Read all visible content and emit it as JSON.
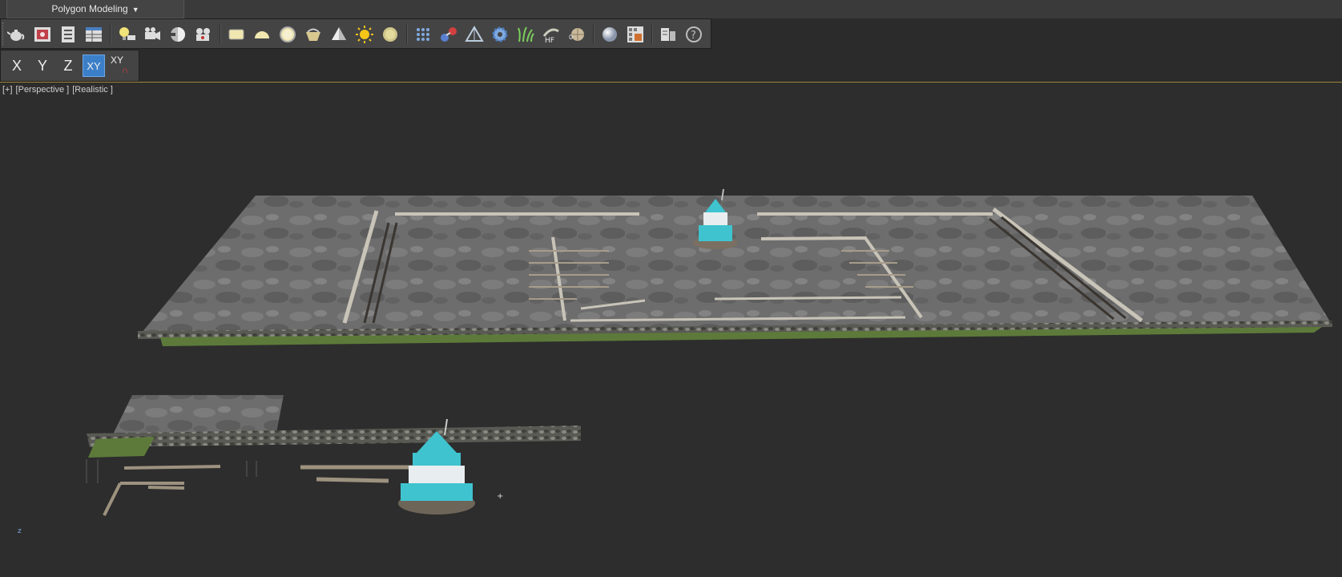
{
  "ribbon": {
    "tab_label": "Polygon Modeling"
  },
  "toolbar": {
    "buttons": [
      "teapot-icon",
      "render-frame-icon",
      "render-setup-icon",
      "render-table-icon",
      "light-lister-icon",
      "camera-icon",
      "camera-sequence-icon",
      "film-icon",
      "plane-icon",
      "hemisphere-icon",
      "sphere-ring-icon",
      "basket-icon",
      "cone-icon",
      "sun-icon",
      "disc-icon",
      "particle-grid-icon",
      "molecule-icon",
      "tent-icon",
      "gear-icon",
      "grass-icon",
      "hf-icon",
      "mesh-ball-icon",
      "material-sphere-icon",
      "material-editor-icon",
      "layer-manager-icon",
      "help-icon"
    ]
  },
  "axis_toolbar": {
    "x": "X",
    "y": "Y",
    "z": "Z",
    "xy": "XY",
    "xy_snap": "XY"
  },
  "viewport": {
    "plus": "[+]",
    "view": "[Perspective ]",
    "shading": "[Realistic ]"
  },
  "colors": {
    "accent": "#3c7fc9",
    "water": "#6e6e6e",
    "grass": "#5d7a3a",
    "tower": "#3fc3cf"
  }
}
